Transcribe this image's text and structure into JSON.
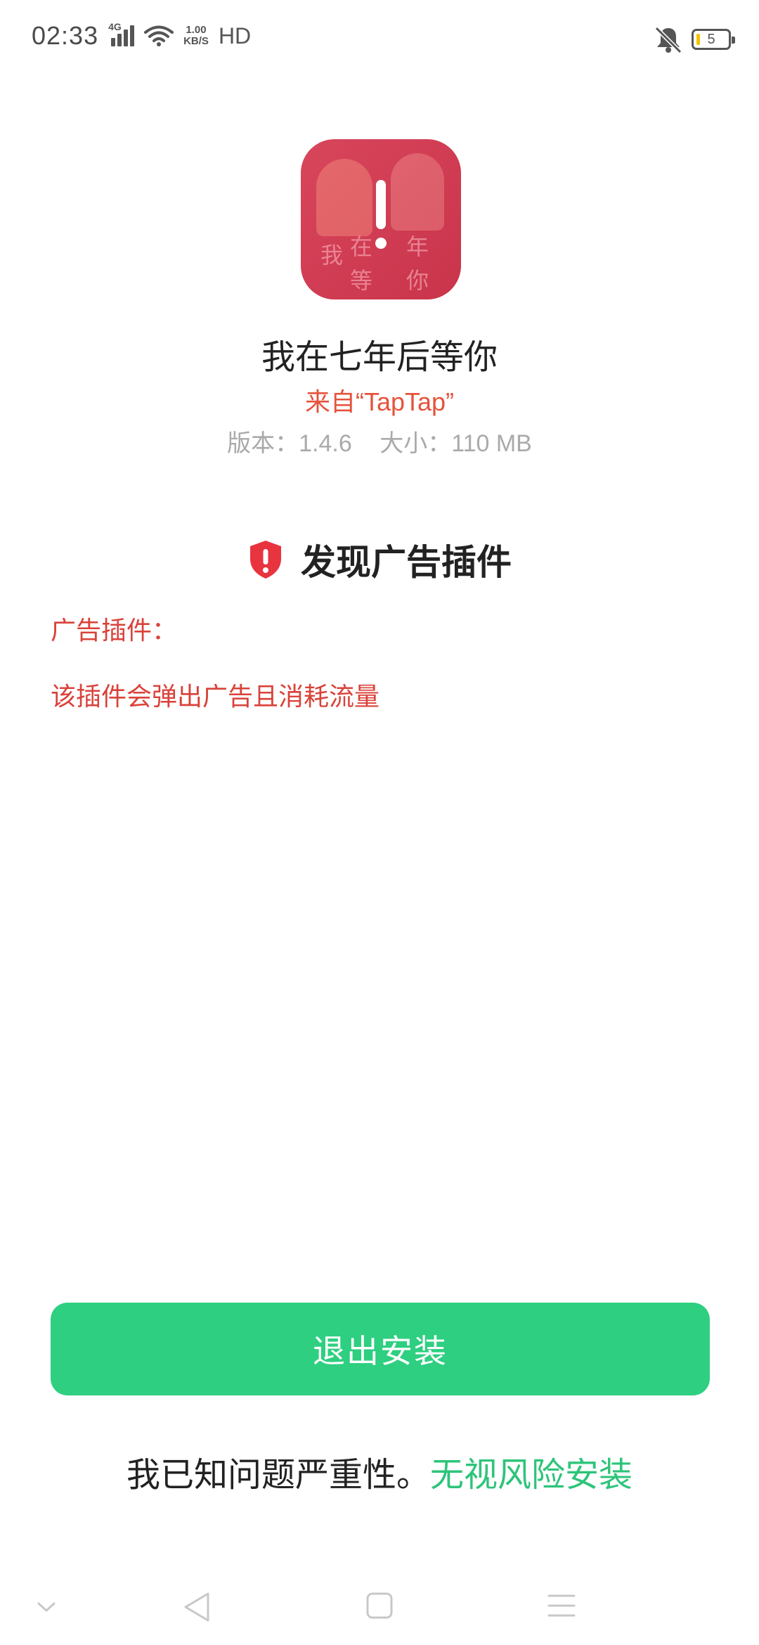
{
  "status_bar": {
    "time": "02:33",
    "network_type": "4G",
    "speed_value": "1.00",
    "speed_unit": "KB/S",
    "hd_label": "HD",
    "battery_level": "5",
    "icons": [
      "signal-icon",
      "wifi-icon",
      "mute-icon",
      "battery-icon"
    ]
  },
  "app": {
    "icon": "app-warning-icon",
    "name": "我在七年后等你",
    "source": "来自“TapTap”",
    "version": "版本：1.4.6",
    "size": "大小：110 MB"
  },
  "warning": {
    "icon": "shield-alert-icon",
    "title": "发现广告插件",
    "plugin_label": "广告插件：",
    "plugin_description": "该插件会弹出广告且消耗流量",
    "color": "#d9423a"
  },
  "actions": {
    "exit_label": "退出安装",
    "exit_color": "#2ecf80",
    "ignore_prefix": "我已知问题严重性。",
    "ignore_link": "无视风险安装"
  },
  "nav_bar": {
    "icons": [
      "collapse-chevron-icon",
      "back-icon",
      "home-icon",
      "menu-icon"
    ]
  }
}
